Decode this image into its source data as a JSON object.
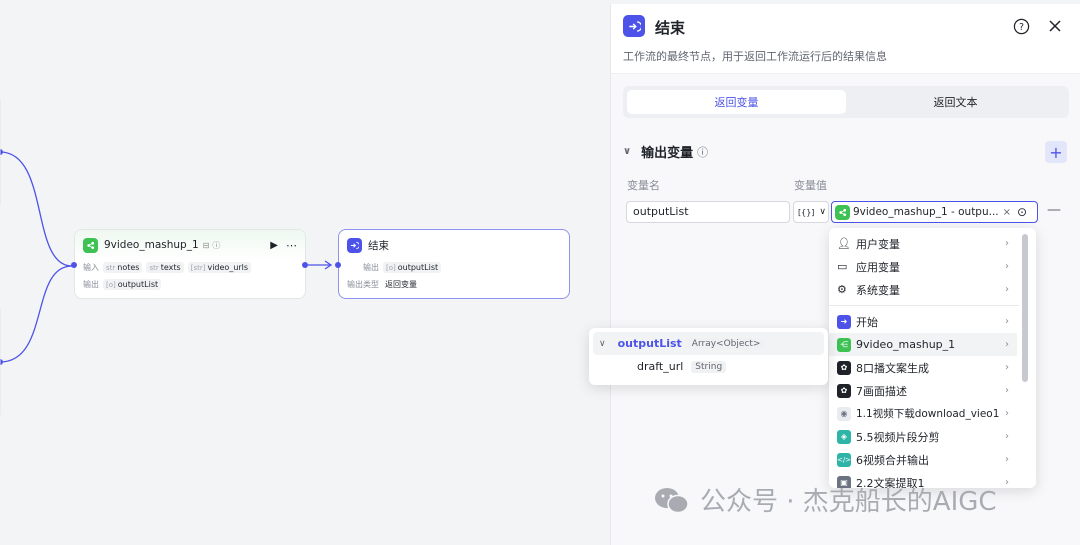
{
  "canvas": {
    "mashup_node": {
      "title": "9video_mashup_1",
      "input_label": "输入",
      "output_label": "输出",
      "inputs": [
        {
          "type": "str",
          "name": "notes"
        },
        {
          "type": "str",
          "name": "texts"
        },
        {
          "type": "[str]",
          "name": "video_urls"
        }
      ],
      "outputs": [
        {
          "type": "[o]",
          "name": "outputList"
        }
      ]
    },
    "end_node": {
      "title": "结束",
      "output_label": "输出",
      "output_type_label": "输出类型",
      "output_var": {
        "type": "[o]",
        "name": "outputList"
      },
      "output_type_value": "返回变量"
    }
  },
  "panel": {
    "title": "结束",
    "description": "工作流的最终节点，用于返回工作流运行后的结果信息",
    "tabs": [
      {
        "label": "返回变量",
        "active": true
      },
      {
        "label": "返回文本",
        "active": false
      }
    ],
    "section_title": "输出变量",
    "col_name": "变量名",
    "col_value": "变量值",
    "var_name": "outputList",
    "type_select": "[{}]",
    "value_ref": "9video_mashup_1 - outpu..."
  },
  "dropdown": {
    "groups": [
      {
        "label": "用户变量",
        "icon": "user-icon"
      },
      {
        "label": "应用变量",
        "icon": "folder-icon"
      },
      {
        "label": "系统变量",
        "icon": "gear-icon"
      }
    ],
    "nodes": [
      {
        "label": "开始",
        "icon": "start-icon",
        "color": "#4d53e8"
      },
      {
        "label": "9video_mashup_1",
        "icon": "plugin-icon",
        "color": "#3ec254"
      },
      {
        "label": "8口播文案生成",
        "icon": "llm-icon",
        "color": "#1f2329"
      },
      {
        "label": "7画面描述",
        "icon": "llm-icon",
        "color": "#1f2329"
      },
      {
        "label": "1.1视频下载download_vieo1",
        "icon": "download-icon",
        "color": "#9aa0a8"
      },
      {
        "label": "5.5视频片段分剪",
        "icon": "layers-icon",
        "color": "#2fb5a7"
      },
      {
        "label": "6视频合并输出",
        "icon": "code-icon",
        "color": "#2fb5a7"
      },
      {
        "label": "2.2文案提取1",
        "icon": "image-icon",
        "color": "#6b7280"
      }
    ]
  },
  "popup": {
    "root_name": "outputList",
    "root_type": "Array<Object>",
    "child_name": "draft_url",
    "child_type": "String"
  },
  "watermark": {
    "text": "公众号 · 杰克船长的AIGC"
  },
  "colors": {
    "accent": "#4d53e8",
    "plugin_green": "#3ec254"
  }
}
